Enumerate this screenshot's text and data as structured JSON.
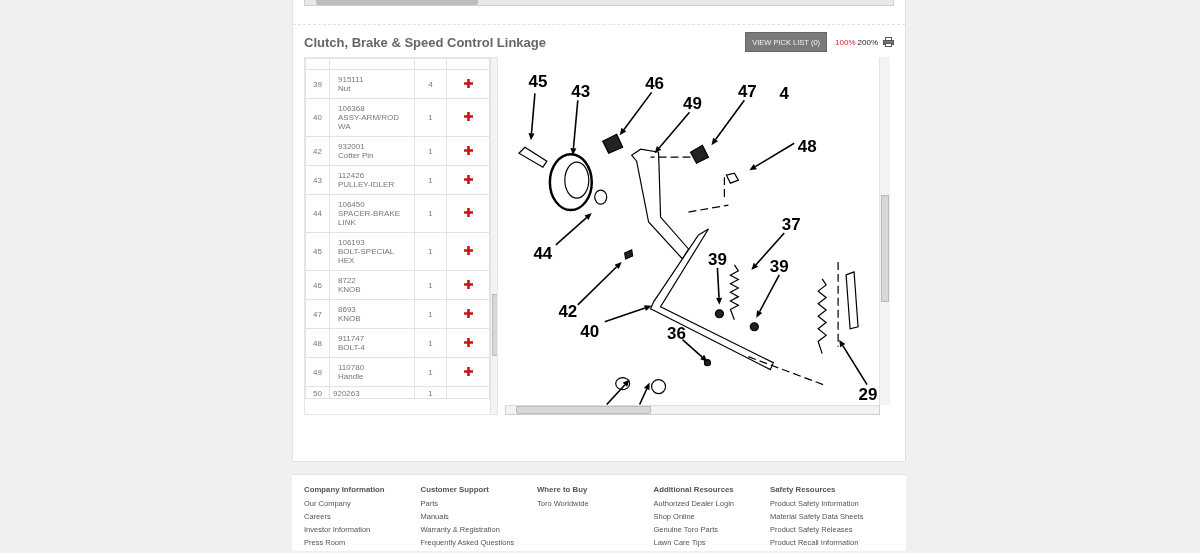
{
  "section": {
    "title": "Clutch, Brake & Speed Control Linkage",
    "pick_list_button": "VIEW PICK LIST (0)",
    "zoom_options": [
      {
        "label": "100%",
        "selected": true
      },
      {
        "label": "200%",
        "selected": false
      }
    ]
  },
  "parts": [
    {
      "ref": "39",
      "part_number": "915111",
      "description": "Nut",
      "qty": "4"
    },
    {
      "ref": "40",
      "part_number": "106368",
      "description": "ASSY-ARM/ROD WA",
      "qty": "1"
    },
    {
      "ref": "42",
      "part_number": "932001",
      "description": "Cotter Pin",
      "qty": "1"
    },
    {
      "ref": "43",
      "part_number": "112426",
      "description": "PULLEY-IDLER",
      "qty": "1"
    },
    {
      "ref": "44",
      "part_number": "106450",
      "description": "SPACER-BRAKE LINK",
      "qty": "1"
    },
    {
      "ref": "45",
      "part_number": "106193",
      "description": "BOLT-SPECIAL HEX",
      "qty": "1"
    },
    {
      "ref": "46",
      "part_number": "8722",
      "description": "KNOB",
      "qty": "1"
    },
    {
      "ref": "47",
      "part_number": "8693",
      "description": "KNOB",
      "qty": "1"
    },
    {
      "ref": "48",
      "part_number": "911747",
      "description": "BOLT-4",
      "qty": "1"
    },
    {
      "ref": "49",
      "part_number": "110780",
      "description": "Handle",
      "qty": "1"
    },
    {
      "ref": "50",
      "part_number": "920263",
      "qty": "1"
    }
  ],
  "diagram": {
    "callouts": [
      "45",
      "43",
      "46",
      "49",
      "47",
      "4",
      "48",
      "44",
      "37",
      "39",
      "39",
      "42",
      "40",
      "36",
      "29"
    ]
  },
  "footer": {
    "columns": [
      {
        "heading": "Company Information",
        "links": [
          "Our Company",
          "Careers",
          "Investor Information",
          "Press Room"
        ]
      },
      {
        "heading": "Customer Support",
        "links": [
          "Parts",
          "Manuals",
          "Warranty & Registration",
          "Frequently Asked Questions"
        ]
      },
      {
        "heading": "Where to Buy",
        "links": [
          "Toro Worldwide"
        ]
      },
      {
        "heading": "Additional Resources",
        "links": [
          "Authorized Dealer Login",
          "Shop Online",
          "Genuine Toro Parts",
          "Lawn Care Tips"
        ]
      },
      {
        "heading": "Safety Resources",
        "links": [
          "Product Safety Information",
          "Material Safety Data Sheets",
          "Product Safety Releases",
          "Product Recall Information"
        ]
      }
    ]
  }
}
